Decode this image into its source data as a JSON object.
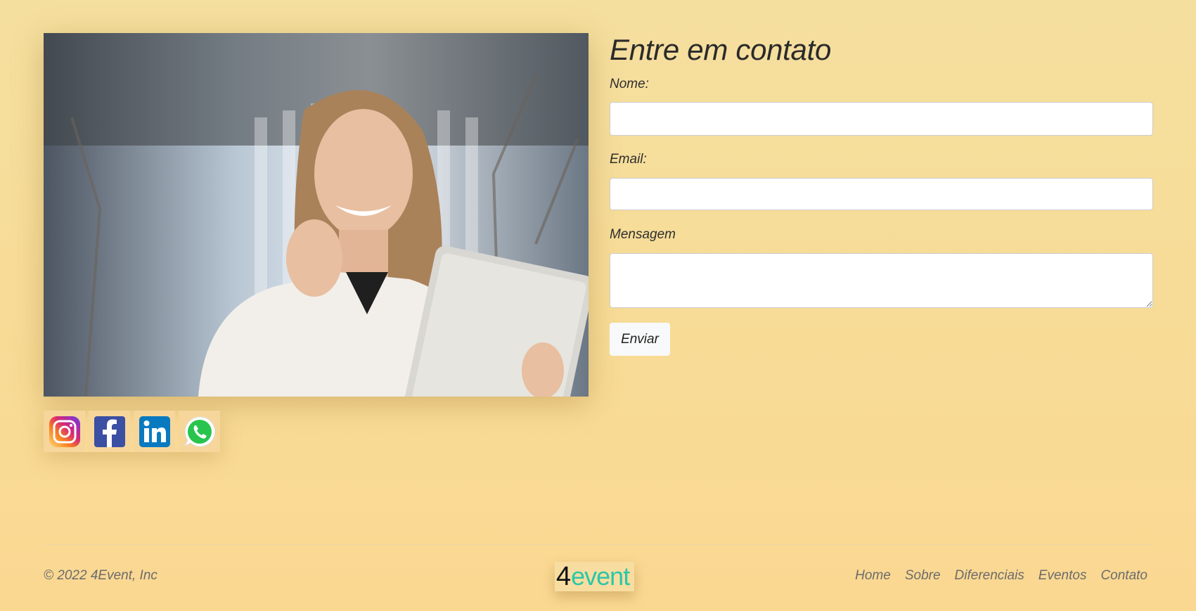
{
  "contact": {
    "title": "Entre em contato",
    "name_label": "Nome:",
    "email_label": "Email:",
    "message_label": "Mensagem",
    "name_value": "",
    "email_value": "",
    "message_value": "",
    "submit_label": "Enviar"
  },
  "social": [
    "instagram-icon",
    "facebook-icon",
    "linkedin-icon",
    "whatsapp-icon"
  ],
  "footer": {
    "copyright": "© 2022 4Event, Inc",
    "logo_number": "4",
    "logo_word": "event",
    "nav": [
      "Home",
      "Sobre",
      "Diferenciais",
      "Eventos",
      "Contato"
    ]
  },
  "colors": {
    "background": "#f6dc9b",
    "logo_accent": "#2cc7a8",
    "instagram": "#c13584",
    "facebook": "#3b5998",
    "linkedin": "#0a66c2",
    "whatsapp": "#25d366"
  }
}
